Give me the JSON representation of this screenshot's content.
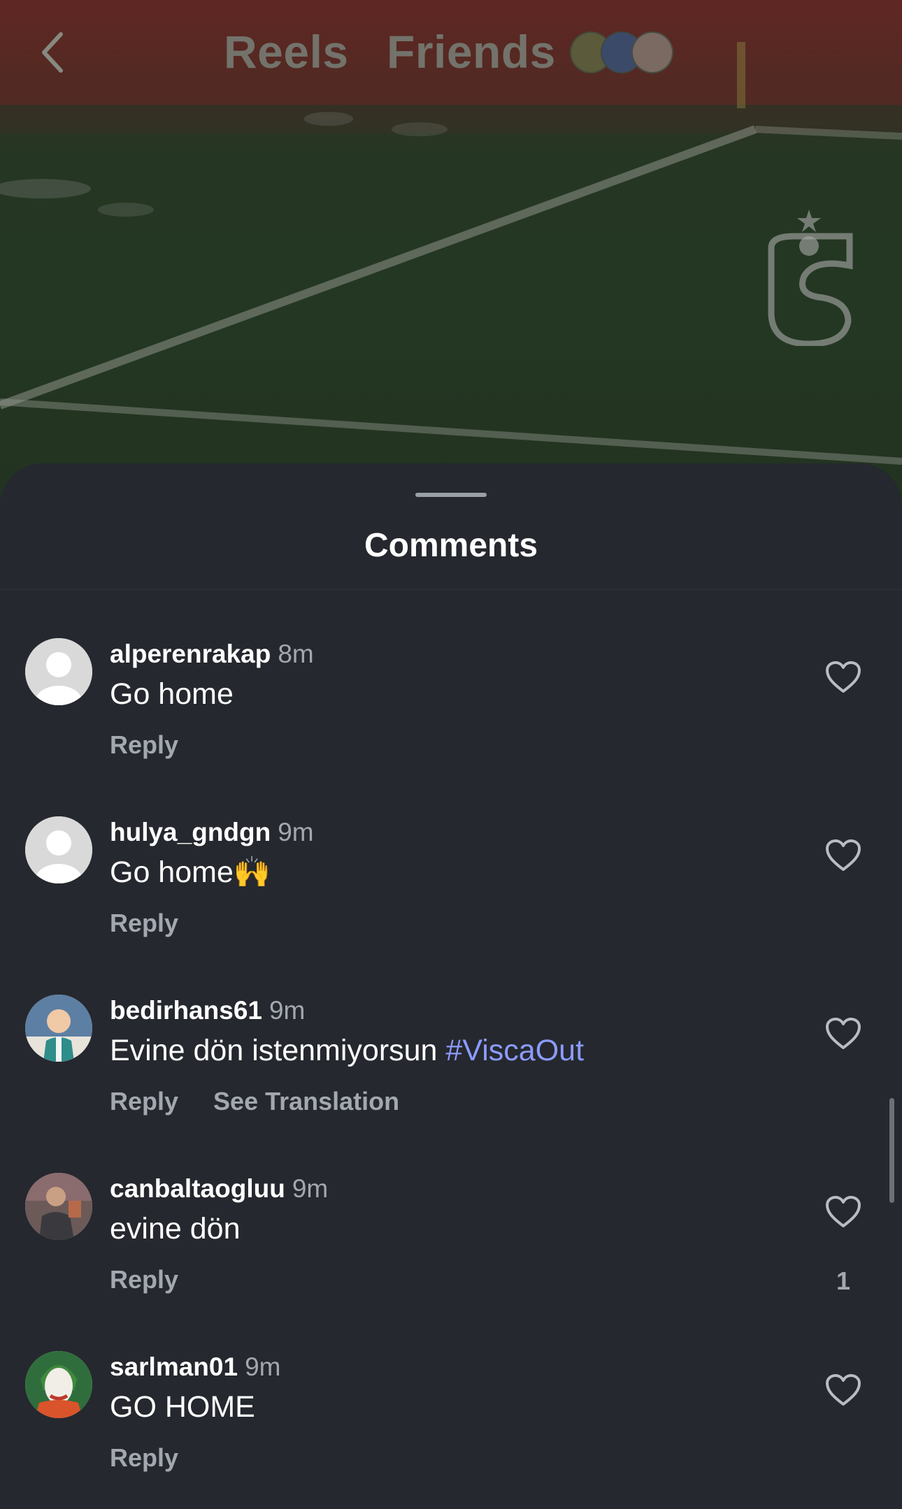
{
  "header": {
    "tabs": [
      {
        "label": "Reels"
      },
      {
        "label": "Friends"
      }
    ]
  },
  "comments_sheet": {
    "title": "Comments",
    "comments": [
      {
        "username": "alperenrakap",
        "time": "8m",
        "text": "Go home",
        "reply_label": "Reply",
        "avatar": "default-avatar"
      },
      {
        "username": "hulya_gndgn",
        "time": "9m",
        "text": "Go home🙌",
        "reply_label": "Reply",
        "avatar": "default-avatar"
      },
      {
        "username": "bedirhans61",
        "time": "9m",
        "text": "Evine dön istenmiyorsun ",
        "hashtag": "#ViscaOut",
        "reply_label": "Reply",
        "translate_label": "See Translation",
        "avatar": "child-photo"
      },
      {
        "username": "canbaltaoglu u",
        "time": "9m",
        "text": "evine dön",
        "reply_label": "Reply",
        "like_count": "1",
        "avatar": "man-photo"
      },
      {
        "username": "sarlman01",
        "time": "9m",
        "text": "GO HOME",
        "reply_label": "Reply",
        "avatar": "joker-photo"
      }
    ]
  },
  "colors": {
    "sheet_bg": "#25282e",
    "secondary_text": "#a3a8b0",
    "hashtag": "#8c9bff"
  },
  "icons": [
    "back-chevron-icon",
    "heart-icon",
    "default-avatar-icon",
    "club-crest-logo"
  ]
}
